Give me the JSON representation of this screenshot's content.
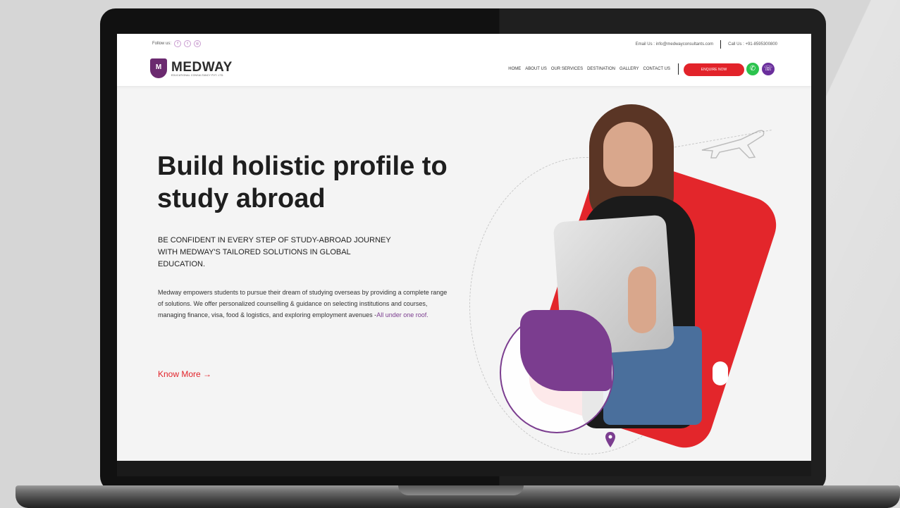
{
  "colors": {
    "brand_red": "#e2232a",
    "brand_purple": "#7b3d8f",
    "whatsapp_green": "#2bc34d"
  },
  "topbar": {
    "follow_label": "Follow us:",
    "social_icons": [
      "facebook-icon",
      "twitter-icon",
      "instagram-icon"
    ],
    "email": "Email Us : info@medwayconsultants.com",
    "phone": "Call Us : +91-8595300800"
  },
  "header": {
    "logo_name": "MEDWAY",
    "logo_tagline": "EDUCATIONAL CONSULTANCY PVT. LTD.",
    "nav": [
      "HOME",
      "ABOUT US",
      "OUR SERVICES",
      "DESTINATION",
      "GALLERY",
      "CONTACT US"
    ],
    "enquire_label": "ENQUIRE NOW"
  },
  "hero": {
    "title": "Build holistic profile to study abroad",
    "subtitle": "BE CONFIDENT IN EVERY STEP OF STUDY-ABROAD JOURNEY WITH MEDWAY'S TAILORED SOLUTIONS IN GLOBAL EDUCATION.",
    "body": "Medway empowers students to pursue their dream of studying overseas by providing a complete range of solutions. We offer personalized counselling & guidance on selecting institutions and courses, managing finance, visa, food & logistics, and exploring employment avenues -",
    "body_accent": "All under one roof.",
    "cta": "Know More →"
  }
}
